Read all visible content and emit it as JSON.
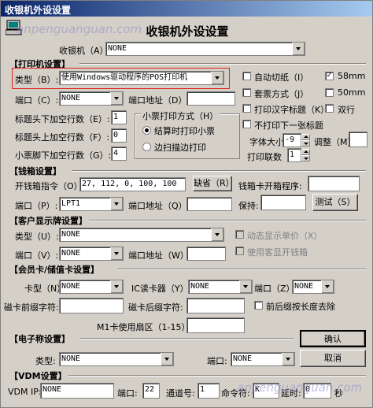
{
  "window": {
    "title": "收银机外设设置",
    "heading": "收银机外设设置"
  },
  "watermark": "anpenguanguan.com",
  "top": {
    "pos_label": "收银机（A）:",
    "pos_value": "NONE"
  },
  "printer": {
    "section": "【打印机设置】",
    "type_label": "类型（B）:",
    "type_value": "使用Windows驱动程序的POS打印机",
    "port_label": "端口（C）:",
    "port_value": "NONE",
    "addr_label": "端口地址（D）:",
    "head_below_label": "标题头下加空行数（E）:",
    "head_below_value": "1",
    "head_above_label": "标题头上加空行数（F）:",
    "head_above_value": "0",
    "foot_below_label": "小票脚下加空行数（G）:",
    "foot_below_value": "4",
    "mode_group": "小票打印方式（H）",
    "mode_opt1": "结算时打印小票",
    "mode_opt2": "边扫描边打印",
    "auto_cut": "自动切纸（I）",
    "paper58": "58mm",
    "set_ticket": "套票方式（J）",
    "paper50": "50mm",
    "print_chinese_title": "打印汉字标题（K）",
    "double_line": "双行",
    "no_next_label": "不打印下一张标题",
    "font_size_label": "字体大小:",
    "font_size_value": "-9",
    "adjust_label": "调整（M）",
    "copies_label": "打印联数（L）:",
    "copies_value": "1"
  },
  "cashbox": {
    "section": "【钱箱设置】",
    "cmd_label": "开钱箱指令（O）:",
    "cmd_value": "27, 112, 0, 100, 100",
    "default_btn": "缺省（R）",
    "card_prog_label": "钱箱卡开箱程序:",
    "port_label": "端口（P）:",
    "port_value": "LPT1",
    "addr_label": "端口地址（Q）:",
    "hold_label": "保持:",
    "test_btn": "测试（S）"
  },
  "display": {
    "section": "【客户显示牌设置】",
    "type_label": "类型（U）:",
    "type_value": "NONE",
    "port_label": "端口（V）:",
    "port_value": "NONE",
    "addr_label": "端口地址（W）:",
    "dynamic_price": "动态显示单价（X）",
    "use_cashbox": "使用客显开钱箱"
  },
  "member": {
    "section": "【会员卡/储值卡设置】",
    "card_type_label": "卡型（N）:",
    "card_type_value": "NONE",
    "ic_reader_label": "IC读卡器（Y）:",
    "ic_reader_value": "NONE",
    "port_label": "端口（Z）:",
    "port_value": "NONE",
    "prefix_label": "磁卡前缀字符:",
    "suffix_label": "磁卡后缀字符:",
    "prefix_len_label": "前后缀按长度去除",
    "m1_label": "M1卡使用扇区（1-15）:"
  },
  "scale": {
    "section": "【电子称设置】",
    "type_label": "类型:",
    "type_value": "NONE",
    "port_label": "端口:",
    "port_value": "NONE"
  },
  "vdm": {
    "section": "【VDM设置】",
    "ip_label": "VDM IP:",
    "ip_value": "NONE",
    "port_label": "端口:",
    "port_value": "22",
    "channel_label": "通道号:",
    "channel_value": "1",
    "cmd_label": "命令符:",
    "cmd_value": "K",
    "delay_label": "延时:",
    "delay_value": "0",
    "sec_label": "秒"
  },
  "buttons": {
    "ok": "确认",
    "cancel": "取消"
  }
}
